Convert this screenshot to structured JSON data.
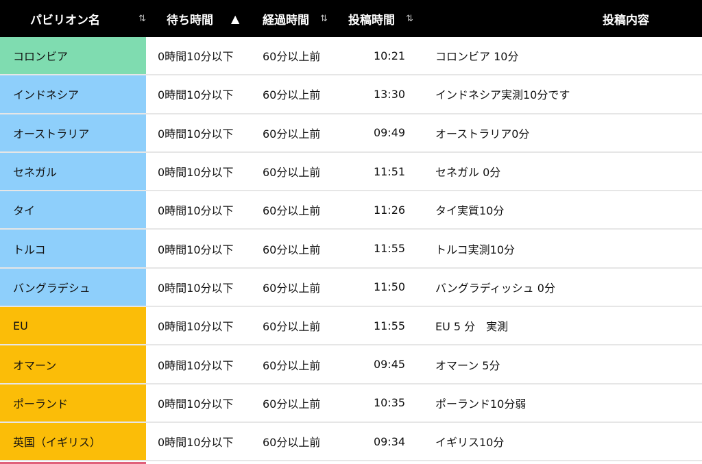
{
  "header": {
    "name": "パビリオン名",
    "name_sort_icon": "⇅",
    "wait": "待ち時間",
    "wait_sort_icon": "▲",
    "elapsed": "経過時間",
    "elapsed_sort_icon": "⇅",
    "posted": "投稿時間",
    "posted_sort_icon": "⇅",
    "content": "投稿内容"
  },
  "colors": {
    "header_bg": "#000000",
    "green": "#7fdcb0",
    "blue": "#8ecffb",
    "orange": "#fbbd08",
    "pink_edge": "#e0607a"
  },
  "rows": [
    {
      "name": "コロンビア",
      "color": "#7fdcb0",
      "wait": "0時間10分以下",
      "elapsed": "60分以上前",
      "posted": "10:21",
      "content": "コロンビア 10分"
    },
    {
      "name": "インドネシア",
      "color": "#8ecffb",
      "wait": "0時間10分以下",
      "elapsed": "60分以上前",
      "posted": "13:30",
      "content": "インドネシア実測10分です"
    },
    {
      "name": "オーストラリア",
      "color": "#8ecffb",
      "wait": "0時間10分以下",
      "elapsed": "60分以上前",
      "posted": "09:49",
      "content": "オーストラリア0分"
    },
    {
      "name": "セネガル",
      "color": "#8ecffb",
      "wait": "0時間10分以下",
      "elapsed": "60分以上前",
      "posted": "11:51",
      "content": "セネガル 0分"
    },
    {
      "name": "タイ",
      "color": "#8ecffb",
      "wait": "0時間10分以下",
      "elapsed": "60分以上前",
      "posted": "11:26",
      "content": "タイ実質10分"
    },
    {
      "name": "トルコ",
      "color": "#8ecffb",
      "wait": "0時間10分以下",
      "elapsed": "60分以上前",
      "posted": "11:55",
      "content": "トルコ実測10分"
    },
    {
      "name": "バングラデシュ",
      "color": "#8ecffb",
      "wait": "0時間10分以下",
      "elapsed": "60分以上前",
      "posted": "11:50",
      "content": "バングラディッシュ 0分"
    },
    {
      "name": "EU",
      "color": "#fbbd08",
      "wait": "0時間10分以下",
      "elapsed": "60分以上前",
      "posted": "11:55",
      "content": "EU 5 分　実測"
    },
    {
      "name": "オマーン",
      "color": "#fbbd08",
      "wait": "0時間10分以下",
      "elapsed": "60分以上前",
      "posted": "09:45",
      "content": "オマーン 5分"
    },
    {
      "name": "ポーランド",
      "color": "#fbbd08",
      "wait": "0時間10分以下",
      "elapsed": "60分以上前",
      "posted": "10:35",
      "content": "ポーランド10分弱"
    },
    {
      "name": "英国（イギリス）",
      "color": "#fbbd08",
      "wait": "0時間10分以下",
      "elapsed": "60分以上前",
      "posted": "09:34",
      "content": "イギリス10分"
    }
  ]
}
